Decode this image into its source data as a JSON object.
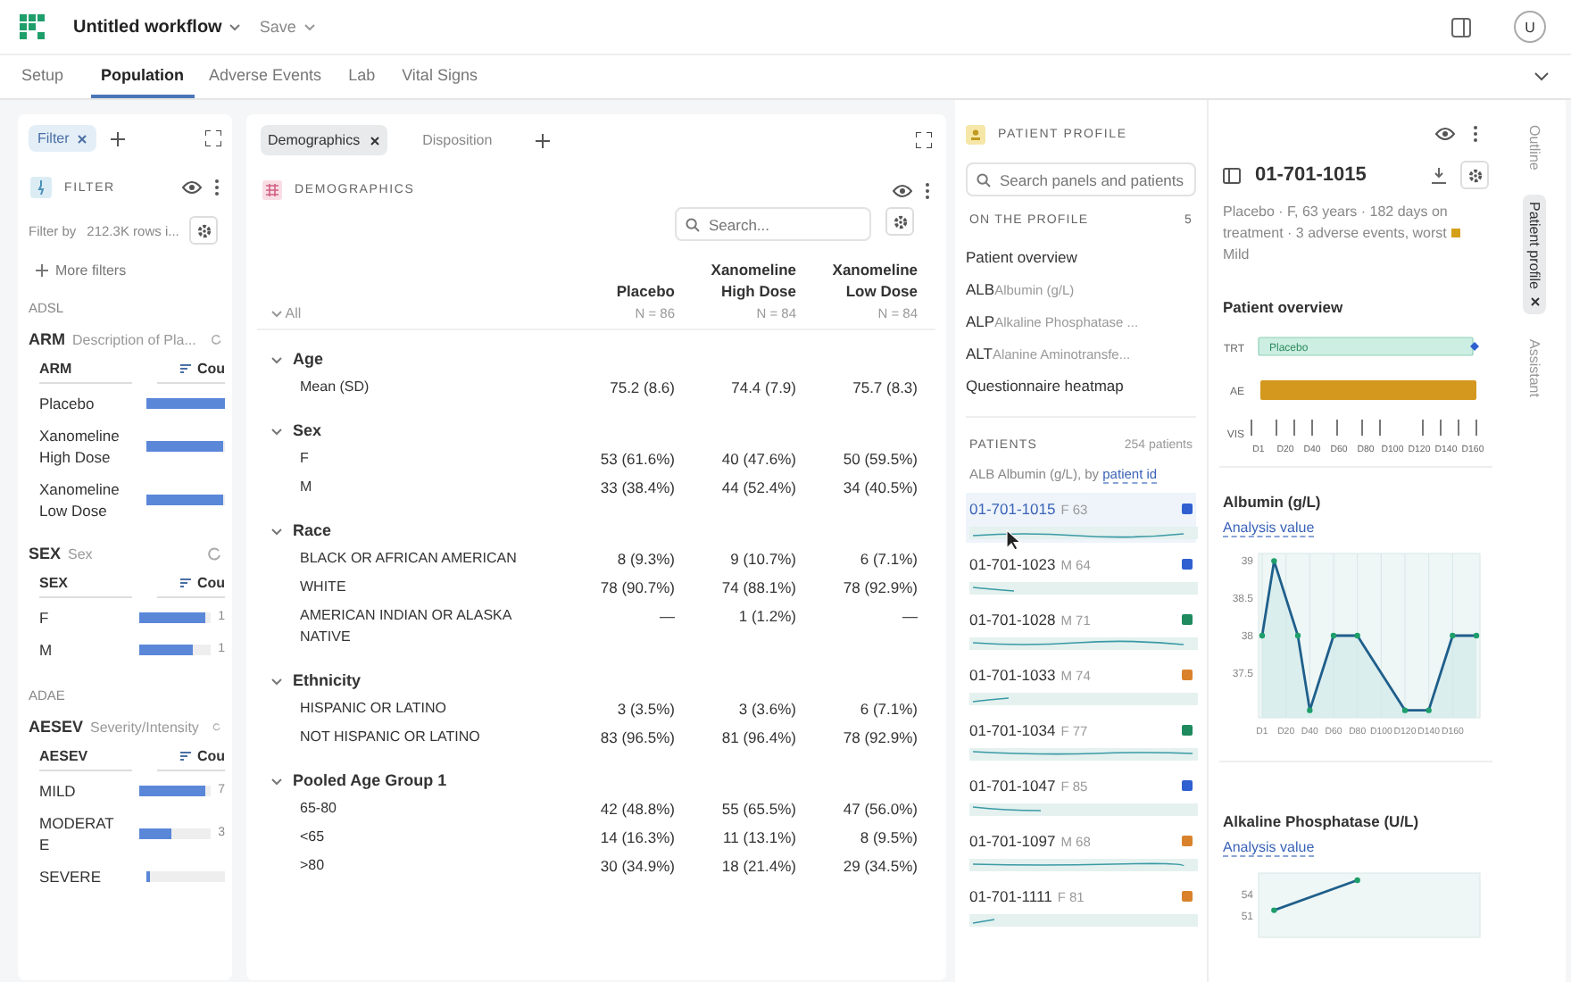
{
  "app": {
    "title": "Untitled workflow",
    "save": "Save",
    "user_initial": "U"
  },
  "tabs": [
    {
      "label": "Setup",
      "selected": false
    },
    {
      "label": "Population",
      "selected": true
    },
    {
      "label": "Adverse Events",
      "selected": false
    },
    {
      "label": "Lab",
      "selected": false
    },
    {
      "label": "Vital Signs",
      "selected": false
    }
  ],
  "filter_panel": {
    "chip": "Filter",
    "title": "FILTER",
    "filter_by": "Filter by",
    "rows_info": "212.3K rows i...",
    "more_filters": "More filters",
    "groups": [
      {
        "dataset": "ADSL",
        "filters": [
          {
            "name": "ARM",
            "description": "Description of Pla...",
            "column": "ARM",
            "count_header": "Cou",
            "rows": [
              {
                "label": "Placebo",
                "level": 1
              },
              {
                "label": "Xanomeline High Dose",
                "level": 0.98
              },
              {
                "label": "Xanomeline Low Dose",
                "level": 0.98
              }
            ]
          },
          {
            "name": "SEX",
            "description": "Sex",
            "column": "SEX",
            "count_header": "Cou",
            "rows": [
              {
                "label": "F",
                "level": 0.93,
                "count": "1"
              },
              {
                "label": "M",
                "level": 0.75,
                "count": "1"
              }
            ]
          }
        ]
      },
      {
        "dataset": "ADAE",
        "filters": [
          {
            "name": "AESEV",
            "description": "Severity/Intensity",
            "column": "AESEV",
            "count_header": "Cou",
            "rows": [
              {
                "label": "MILD",
                "level": 0.93,
                "count": "7"
              },
              {
                "label": "MODERATE",
                "level": 0.45,
                "count": "3"
              },
              {
                "label": "SEVERE",
                "level": 0.05
              }
            ]
          }
        ]
      }
    ]
  },
  "view_tabs": [
    {
      "label": "Demographics",
      "selected": true
    },
    {
      "label": "Disposition",
      "selected": false
    }
  ],
  "table": {
    "title": "DEMOGRAPHICS",
    "search_placeholder": "Search...",
    "all_label": "All",
    "columns": [
      {
        "name": "Placebo",
        "n": "N = 86"
      },
      {
        "name": "Xanomeline High Dose",
        "n": "N = 84"
      },
      {
        "name": "Xanomeline Low Dose",
        "n": "N = 84"
      }
    ],
    "sections": [
      {
        "title": "Age",
        "rows": [
          {
            "label": "Mean (SD)",
            "values": [
              "75.2 (8.6)",
              "74.4 (7.9)",
              "75.7 (8.3)"
            ]
          }
        ]
      },
      {
        "title": "Sex",
        "rows": [
          {
            "label": "F",
            "values": [
              "53 (61.6%)",
              "40 (47.6%)",
              "50 (59.5%)"
            ]
          },
          {
            "label": "M",
            "values": [
              "33 (38.4%)",
              "44 (52.4%)",
              "34 (40.5%)"
            ]
          }
        ]
      },
      {
        "title": "Race",
        "rows": [
          {
            "label": "BLACK OR AFRICAN AMERICAN",
            "values": [
              "8 (9.3%)",
              "9 (10.7%)",
              "6 (7.1%)"
            ]
          },
          {
            "label": "WHITE",
            "values": [
              "78 (90.7%)",
              "74 (88.1%)",
              "78 (92.9%)"
            ]
          },
          {
            "label": "AMERICAN INDIAN OR ALASKA NATIVE",
            "values": [
              "—",
              "1 (1.2%)",
              "—"
            ]
          }
        ]
      },
      {
        "title": "Ethnicity",
        "rows": [
          {
            "label": "HISPANIC OR LATINO",
            "values": [
              "3 (3.5%)",
              "3 (3.6%)",
              "6 (7.1%)"
            ]
          },
          {
            "label": "NOT HISPANIC OR LATINO",
            "values": [
              "83 (96.5%)",
              "81 (96.4%)",
              "78 (92.9%)"
            ]
          }
        ]
      },
      {
        "title": "Pooled Age Group 1",
        "rows": [
          {
            "label": "65-80",
            "values": [
              "42 (48.8%)",
              "55 (65.5%)",
              "47 (56.0%)"
            ]
          },
          {
            "label": "<65",
            "values": [
              "14 (16.3%)",
              "11 (13.1%)",
              "8 (9.5%)"
            ]
          },
          {
            "label": ">80",
            "values": [
              "30 (34.9%)",
              "18 (21.4%)",
              "29 (34.5%)"
            ]
          }
        ]
      }
    ]
  },
  "profile": {
    "title": "PATIENT PROFILE",
    "search_placeholder": "Search panels and patients",
    "on_profile": "ON THE PROFILE",
    "on_profile_count": "5",
    "panels": [
      {
        "name": "Patient overview"
      },
      {
        "code": "ALB",
        "name": "Albumin (g/L)"
      },
      {
        "code": "ALP",
        "name": "Alkaline Phosphatase ..."
      },
      {
        "code": "ALT",
        "name": "Alanine Aminotransfe..."
      },
      {
        "name": "Questionnaire heatmap"
      }
    ],
    "patients_label": "PATIENTS",
    "patients_count": "254 patients",
    "patients_by": "ALB Albumin (g/L), by",
    "patients_by_link": "patient id",
    "patients": [
      {
        "id": "01-701-1015",
        "meta": "F 63",
        "color": "#2f5fd0",
        "selected": true
      },
      {
        "id": "01-701-1023",
        "meta": "M 64",
        "color": "#2f5fd0",
        "selected": false
      },
      {
        "id": "01-701-1028",
        "meta": "M 71",
        "color": "#1e8a5e",
        "selected": false
      },
      {
        "id": "01-701-1033",
        "meta": "M 74",
        "color": "#d9822b",
        "selected": false
      },
      {
        "id": "01-701-1034",
        "meta": "F 77",
        "color": "#1e8a5e",
        "selected": false
      },
      {
        "id": "01-701-1047",
        "meta": "F 85",
        "color": "#2f5fd0",
        "selected": false
      },
      {
        "id": "01-701-1097",
        "meta": "M 68",
        "color": "#d9822b",
        "selected": false
      },
      {
        "id": "01-701-1111",
        "meta": "F 81",
        "color": "#d9822b",
        "selected": false
      }
    ]
  },
  "detail": {
    "patient_id": "01-701-1015",
    "summary": "Placebo · F, 63 years · 182 days on treatment · 3 adverse events, worst",
    "worst": "Mild",
    "overview": {
      "title": "Patient overview",
      "rows": [
        "TRT",
        "AE",
        "VIS"
      ],
      "treatment_label": "Placebo",
      "xticks": [
        "D1",
        "D20",
        "D40",
        "D60",
        "D80",
        "D100",
        "D120",
        "D140",
        "D160"
      ]
    },
    "charts": [
      {
        "title": "Albumin (g/L)",
        "link": "Analysis value",
        "chart_data": {
          "type": "area",
          "grid": true,
          "categories": [
            "D1",
            null,
            "D20",
            null,
            "D40",
            null,
            "D60",
            null,
            "D80",
            null,
            "D100",
            null,
            "D120",
            null,
            "D140",
            null,
            "D160",
            null,
            null
          ],
          "series": [
            {
              "color": "#1f5f8b",
              "marker": "circle",
              "values": [
                38,
                39,
                null,
                38,
                37,
                null,
                38,
                null,
                38,
                null,
                null,
                null,
                37,
                null,
                37,
                null,
                38,
                null,
                38
              ]
            }
          ],
          "ylim": [
            36.9,
            39.1
          ],
          "yticks": [
            37.5,
            38,
            38.5,
            39
          ]
        }
      },
      {
        "title": "Alkaline Phosphatase (U/L)",
        "link": "Analysis value",
        "chart_data": {
          "type": "line",
          "categories": [
            null,
            null,
            null,
            null,
            null,
            null,
            null,
            null,
            null,
            null,
            null,
            null,
            null,
            null,
            null,
            null,
            null,
            null,
            null
          ],
          "series": [
            {
              "color": "#1f5f8b",
              "marker": "circle",
              "values": [
                null,
                51.8,
                null,
                null,
                null,
                null,
                null,
                null,
                56,
                null,
                null,
                null,
                null,
                null,
                null,
                null,
                null,
                null,
                null
              ]
            }
          ],
          "ylim": [
            48,
            57
          ],
          "yticks": [
            51,
            54
          ]
        }
      }
    ]
  },
  "side_tabs": [
    {
      "label": "Outline",
      "selected": false
    },
    {
      "label": "Patient profile",
      "selected": true
    },
    {
      "label": "Assistant",
      "selected": false
    }
  ]
}
